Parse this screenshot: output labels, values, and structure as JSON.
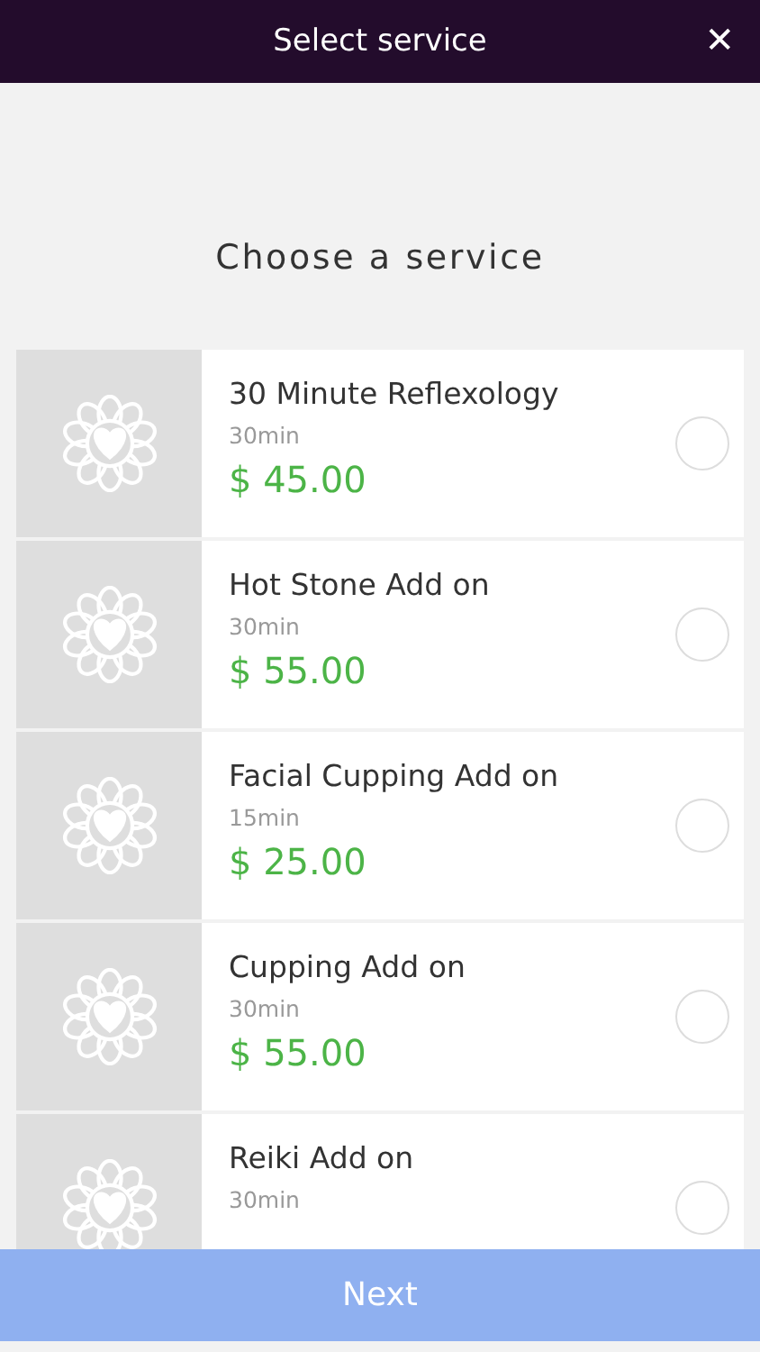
{
  "header": {
    "title": "Select service",
    "close": "✕"
  },
  "heading": "Choose a service",
  "services": [
    {
      "name": "30 Minute Reflexology",
      "duration": "30min",
      "price": "$ 45.00",
      "selected": false
    },
    {
      "name": "Hot Stone Add on",
      "duration": "30min",
      "price": "$ 55.00",
      "selected": false
    },
    {
      "name": "Facial Cupping Add on",
      "duration": "15min",
      "price": "$ 25.00",
      "selected": false
    },
    {
      "name": "Cupping Add on",
      "duration": "30min",
      "price": "$ 55.00",
      "selected": false
    },
    {
      "name": "Reiki Add on",
      "duration": "30min",
      "selected": false
    }
  ],
  "next_button": {
    "label": "Next",
    "disabled": true
  }
}
